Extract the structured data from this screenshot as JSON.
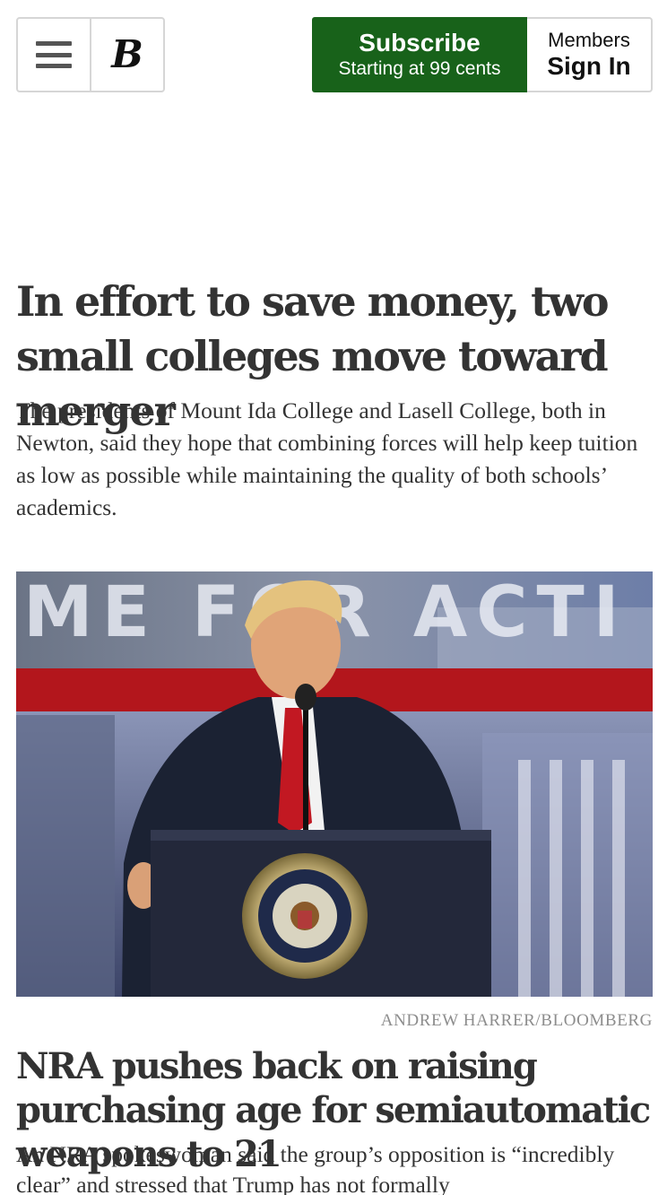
{
  "header": {
    "logo_text": "B",
    "subscribe": {
      "title": "Subscribe",
      "subtitle": "Starting at 99 cents"
    },
    "sign_in": {
      "top": "Members",
      "main": "Sign In"
    }
  },
  "stories": [
    {
      "headline": "In effort to save money, two small colleges move toward merger",
      "summary": "The presidents of Mount Ida College and Lasell College, both in Newton, said they hope that combining forces will help keep tuition as low as possible while maintaining the quality of both schools’ academics."
    },
    {
      "photo_credit": "ANDREW HARRER/BLOOMBERG",
      "photo_banner_text": "ME FOR ACTI",
      "headline": "NRA pushes back on raising purchasing age for semiautomatic weapons to 21",
      "summary": "An NRA spokeswoman said the group’s opposition is “incredibly clear” and stressed that Trump has not formally"
    }
  ],
  "colors": {
    "subscribe_green": "#18621a",
    "border_gray": "#d6d6d6",
    "headline": "#333333",
    "credit_gray": "#8d8d8d"
  },
  "icons": [
    "hamburger-icon",
    "boston-globe-logo"
  ]
}
